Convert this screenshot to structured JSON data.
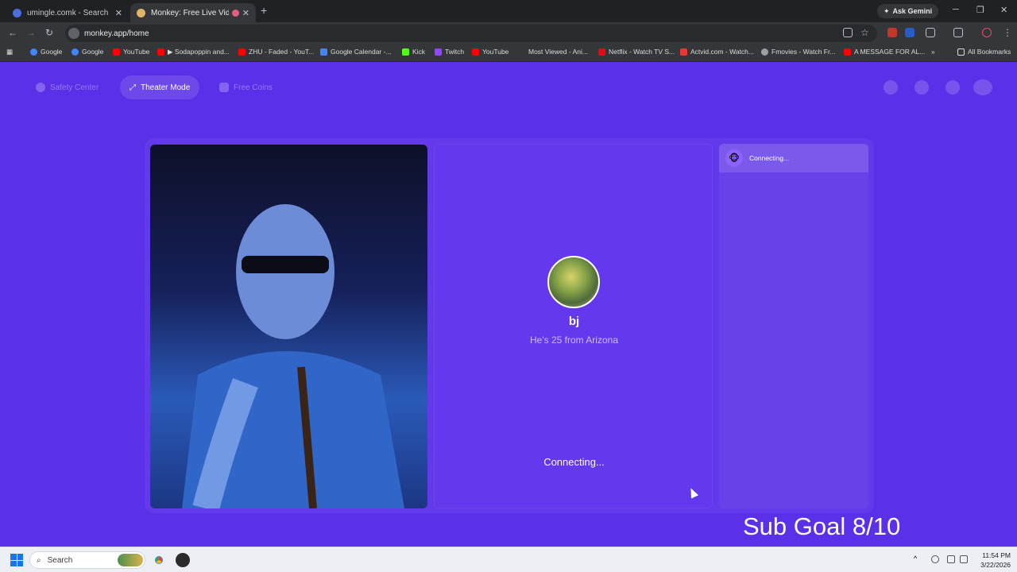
{
  "browser": {
    "tabs": [
      {
        "title": "umingle.comk - Search",
        "close": "✕"
      },
      {
        "title": "Monkey: Free Live Video Ch",
        "close": "✕"
      }
    ],
    "new_tab": "+",
    "ask_gemini": "Ask Gemini",
    "url": "monkey.app/home",
    "window_controls": {
      "minimize": "─",
      "maximize": "❐",
      "close": "✕"
    },
    "nav": {
      "back": "←",
      "forward": "→",
      "reload": "↻"
    },
    "bookmarks": [
      {
        "label": "Google",
        "color": "#4285f4"
      },
      {
        "label": "Google",
        "color": "#4285f4"
      },
      {
        "label": "YouTube",
        "color": "#ff0000"
      },
      {
        "label": "▶ Sodapoppin and...",
        "color": "#ff0000"
      },
      {
        "label": "ZHU - Faded - YouT...",
        "color": "#ff0000"
      },
      {
        "label": "Google Calendar -...",
        "color": "#4285f4"
      },
      {
        "label": "Kick",
        "color": "#53fc18"
      },
      {
        "label": "Twitch",
        "color": "#9146ff"
      },
      {
        "label": "YouTube",
        "color": "#ff0000"
      },
      {
        "label": "Most Viewed - Ani...",
        "color": "#35363a"
      },
      {
        "label": "Netflix - Watch TV S...",
        "color": "#e50914"
      },
      {
        "label": "Actvid.com - Watch...",
        "color": "#e53935"
      },
      {
        "label": "Fmovies - Watch Fr...",
        "color": "#9aa0a6"
      },
      {
        "label": "A MESSAGE FOR AL...",
        "color": "#ff0000"
      }
    ],
    "bookmarks_more": "»",
    "all_bookmarks": "All Bookmarks"
  },
  "page": {
    "nav": {
      "safety": "Safety Center",
      "theater": "Theater Mode",
      "coins": "Free Coins"
    },
    "match": {
      "name": "bj",
      "description": "He's 25 from Arizona",
      "status": "Connecting..."
    },
    "chat": {
      "status": "Connecting...",
      "avatar_emoji": "🐵"
    },
    "overlay": "Sub Goal 8/10"
  },
  "taskbar": {
    "search": "Search",
    "time": "11:54 PM",
    "date": "3/22/2026"
  },
  "colors": {
    "brand_purple": "#5a30e8",
    "panel_purple": "#6438ec"
  }
}
